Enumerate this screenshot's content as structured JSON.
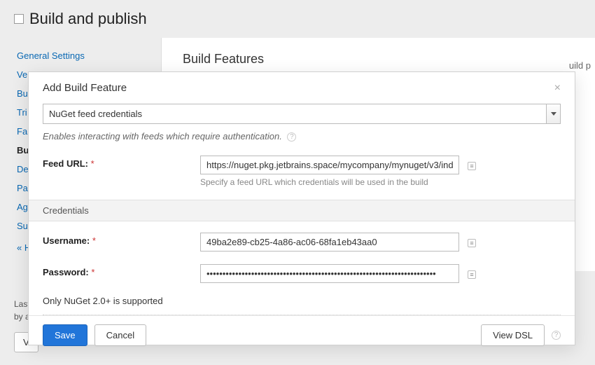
{
  "page": {
    "title": "Build and publish"
  },
  "sidebar": {
    "items": [
      {
        "label": "General Settings",
        "active": false
      },
      {
        "label": "Ve",
        "active": false
      },
      {
        "label": "Bu",
        "active": false
      },
      {
        "label": "Tri",
        "active": false
      },
      {
        "label": "Fai",
        "active": false
      },
      {
        "label": "Bu",
        "active": true
      },
      {
        "label": "De",
        "active": false
      },
      {
        "label": "Pa",
        "active": false
      },
      {
        "label": "Ag",
        "active": false
      },
      {
        "label": "Su",
        "active": false
      }
    ],
    "back": "« H"
  },
  "content": {
    "title": "Build Features",
    "tail": "uild p"
  },
  "footer": {
    "line1": "Last",
    "line2": "by a"
  },
  "bottom_button": "V",
  "modal": {
    "title": "Add Build Feature",
    "feature_select": "NuGet feed credentials",
    "description": "Enables interacting with feeds which require authentication.",
    "feed_url": {
      "label": "Feed URL:",
      "value": "https://nuget.pkg.jetbrains.space/mycompany/mynuget/v3/ind",
      "hint": "Specify a feed URL which credentials will be used in the build"
    },
    "credentials_heading": "Credentials",
    "username": {
      "label": "Username:",
      "value": "49ba2e89-cb25-4a86-ac06-68fa1eb43aa0"
    },
    "password": {
      "label": "Password:",
      "value": "••••••••••••••••••••••••••••••••••••••••••••••••••••••••••••••••••••••••"
    },
    "note": "Only NuGet 2.0+ is supported",
    "buttons": {
      "save": "Save",
      "cancel": "Cancel",
      "view_dsl": "View DSL"
    }
  }
}
